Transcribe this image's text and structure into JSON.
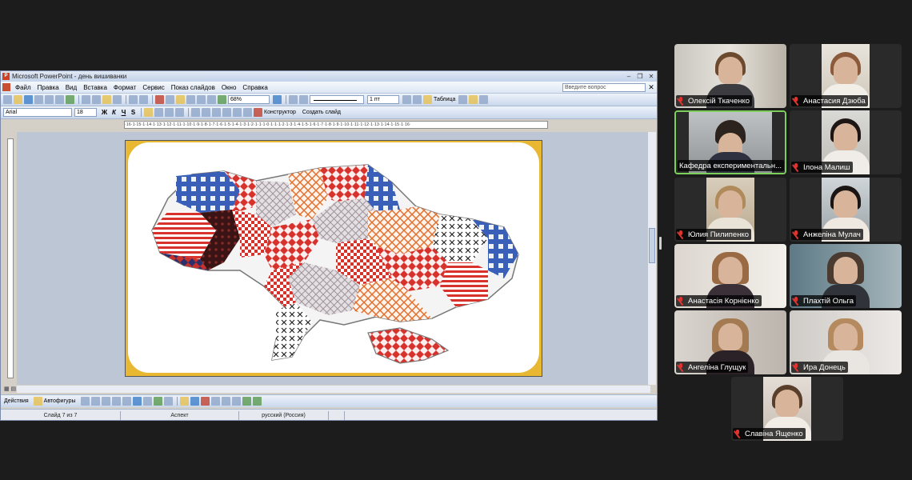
{
  "ppt": {
    "window_title": "Microsoft PowerPoint - день вишиванки",
    "menu": [
      "Файл",
      "Правка",
      "Вид",
      "Вставка",
      "Формат",
      "Сервис",
      "Показ слайдов",
      "Окно",
      "Справка"
    ],
    "help_placeholder": "Введите вопрос",
    "zoom": "68%",
    "line_weight": "1 пт",
    "table_label": "Таблица",
    "font_name": "Arial",
    "font_size": "18",
    "format_buttons": [
      "Ж",
      "К",
      "Ч",
      "S"
    ],
    "designer_label": "Конструктор",
    "new_slide_label": "Создать слайд",
    "ruler_text": "·16·1·15·1·14·1·13·1·12·1·11·1·10·1·9·1·8·1·7·1·6·1·5·1·4·1·3·1·2·1·1·1·0·1·1·1·2·1·3·1·4·1·5·1·6·1·7·1·8·1·9·1·10·1·11·1·12·1·13·1·14·1·15·1·16·",
    "draw_actions": "Действия",
    "draw_autoshapes": "Автофигуры",
    "status": {
      "slide": "Слайд 7 из 7",
      "design": "Аспект",
      "language": "русский (Россия)"
    }
  },
  "participants": [
    {
      "name": "Олексій Ткаченко",
      "muted": true,
      "active": false
    },
    {
      "name": "Анастасия Дзюба",
      "muted": true,
      "active": false
    },
    {
      "name": "Кафедра експериментальн...",
      "muted": false,
      "active": true
    },
    {
      "name": "Ілона Малиш",
      "muted": true,
      "active": false
    },
    {
      "name": "Юлия Пилипенко",
      "muted": true,
      "active": false
    },
    {
      "name": "Анжеліна Мулач",
      "muted": true,
      "active": false
    },
    {
      "name": "Анастасія Корнієнко",
      "muted": true,
      "active": false
    },
    {
      "name": "Плахтій Ольга",
      "muted": true,
      "active": false
    },
    {
      "name": "Ангеліна Глущук",
      "muted": true,
      "active": false
    },
    {
      "name": "Ира Донець",
      "muted": true,
      "active": false
    },
    {
      "name": "Славіна Ященко",
      "muted": true,
      "active": false
    }
  ],
  "colors": {
    "slide_frame": "#e8b832",
    "active_speaker": "#7ccf5a",
    "mute": "#e0332f",
    "embroidery_red": "#d8322c",
    "embroidery_blue": "#3a5fb8"
  }
}
